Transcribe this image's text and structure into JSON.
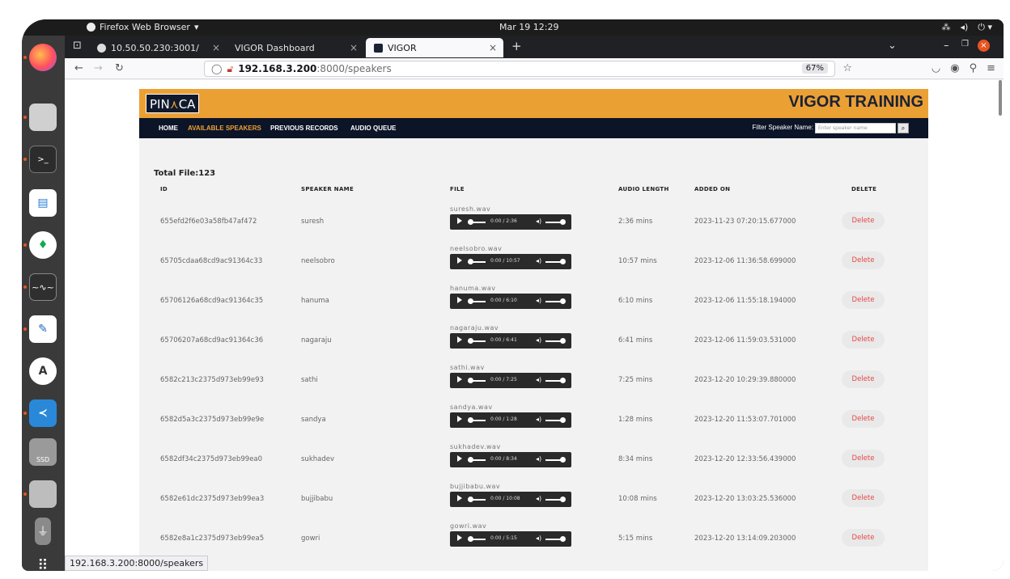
{
  "system": {
    "app_name": "Firefox Web Browser",
    "clock": "Mar 19  12:29"
  },
  "dock": {
    "items": [
      "firefox-icon",
      "files-icon",
      "terminal-icon",
      "writer-icon",
      "mongodb-icon",
      "system-monitor-icon",
      "text-editor-icon",
      "app-center-icon",
      "vscode-icon",
      "ssd-icon",
      "drive-icon",
      "usb-icon",
      "app-grid-icon"
    ],
    "ssd_label": "SSD"
  },
  "browser": {
    "tabs": [
      {
        "label": "10.50.50.230:3001/"
      },
      {
        "label": "VIGOR Dashboard"
      },
      {
        "label": "VIGOR"
      }
    ],
    "url_host": "192.168.3.200",
    "url_rest": ":8000/speakers",
    "zoom": "67%",
    "status_url": "192.168.3.200:8000/speakers"
  },
  "page": {
    "logo_left": "PIN",
    "logo_accent": "⋏",
    "logo_right": "CA",
    "brand": "VIGOR TRAINING",
    "menu": [
      "HOME",
      "AVAILABLE SPEAKERS",
      "PREVIOUS RECORDS",
      "AUDIO QUEUE"
    ],
    "filter_label": "Filter Speaker Name:",
    "filter_placeholder": "Enter speaker name",
    "total": "Total File:123",
    "headers": [
      "ID",
      "SPEAKER NAME",
      "FILE",
      "AUDIO LENGTH",
      "ADDED ON",
      "DELETE"
    ],
    "delete_label": "Delete",
    "rows": [
      {
        "id": "655efd2f6e03a58fb47af472",
        "name": "suresh",
        "file": "suresh.wav",
        "time": "0:00 / 2:36",
        "length": "2:36 mins",
        "added": "2023-11-23 07:20:15.677000"
      },
      {
        "id": "65705cdaa68cd9ac91364c33",
        "name": "neelsobro",
        "file": "neelsobro.wav",
        "time": "0:00 / 10:57",
        "length": "10:57 mins",
        "added": "2023-12-06 11:36:58.699000"
      },
      {
        "id": "65706126a68cd9ac91364c35",
        "name": "hanuma",
        "file": "hanuma.wav",
        "time": "0:00 / 6:10",
        "length": "6:10 mins",
        "added": "2023-12-06 11:55:18.194000"
      },
      {
        "id": "65706207a68cd9ac91364c36",
        "name": "nagaraju",
        "file": "nagaraju.wav",
        "time": "0:00 / 6:41",
        "length": "6:41 mins",
        "added": "2023-12-06 11:59:03.531000"
      },
      {
        "id": "6582c213c2375d973eb99e93",
        "name": "sathi",
        "file": "sathi.wav",
        "time": "0:00 / 7:25",
        "length": "7:25 mins",
        "added": "2023-12-20 10:29:39.880000"
      },
      {
        "id": "6582d5a3c2375d973eb99e9e",
        "name": "sandya",
        "file": "sandya.wav",
        "time": "0:00 / 1:28",
        "length": "1:28 mins",
        "added": "2023-12-20 11:53:07.701000"
      },
      {
        "id": "6582df34c2375d973eb99ea0",
        "name": "sukhadev",
        "file": "sukhadev.wav",
        "time": "0:00 / 8:34",
        "length": "8:34 mins",
        "added": "2023-12-20 12:33:56.439000"
      },
      {
        "id": "6582e61dc2375d973eb99ea3",
        "name": "bujjibabu",
        "file": "bujjibabu.wav",
        "time": "0:00 / 10:08",
        "length": "10:08 mins",
        "added": "2023-12-20 13:03:25.536000"
      },
      {
        "id": "6582e8a1c2375d973eb99ea5",
        "name": "gowri",
        "file": "gowri.wav",
        "time": "0:00 / 5:15",
        "length": "5:15 mins",
        "added": "2023-12-20 13:14:09.203000"
      }
    ]
  }
}
